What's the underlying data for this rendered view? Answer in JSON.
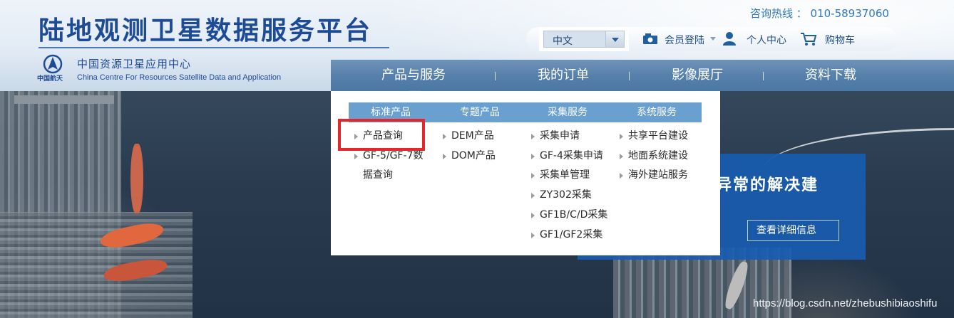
{
  "header": {
    "site_title": "陆地观测卫星数据服务平台",
    "org_name_cn": "中国资源卫星应用中心",
    "org_name_en": "China Centre For Resources Satellite Data and Application",
    "logo_caption": "中国航天",
    "logo_icon": "casc-emblem-icon",
    "hotline": "咨询热线 ： 010-58937060"
  },
  "utility": {
    "language_value": "中文",
    "login_label": "会员登陆",
    "personal_center_label": "个人中心",
    "cart_label": "购物车"
  },
  "nav": {
    "items": [
      {
        "label": "产品与服务"
      },
      {
        "label": "我的订单"
      },
      {
        "label": "影像展厅"
      },
      {
        "label": "资料下载"
      }
    ]
  },
  "dropdown": {
    "columns": [
      {
        "title": "标准产品",
        "links": [
          "产品查询",
          "GF-5/GF-7数",
          "据查询"
        ]
      },
      {
        "title": "专题产品",
        "links": [
          "DEM产品",
          "DOM产品"
        ]
      },
      {
        "title": "采集服务",
        "links": [
          "采集申请",
          "GF-4采集申请",
          "采集单管理",
          "ZY302采集",
          "GF1B/C/D采集",
          "GF1/GF2采集"
        ]
      },
      {
        "title": "系统服务",
        "links": [
          "共享平台建设",
          "地面系统建设",
          "海外建站服务"
        ]
      }
    ]
  },
  "promo": {
    "text": "异常的解决建",
    "button_label": "查看详细信息"
  },
  "watermark": "https://blog.csdn.net/zhebushibiaoshifu",
  "colors": {
    "brand_blue": "#1d4b95",
    "nav_blue": "#5781ab",
    "dropdown_header": "#69a0cf",
    "highlight_red": "#e5262a",
    "promo_blue": "#185cb0"
  }
}
